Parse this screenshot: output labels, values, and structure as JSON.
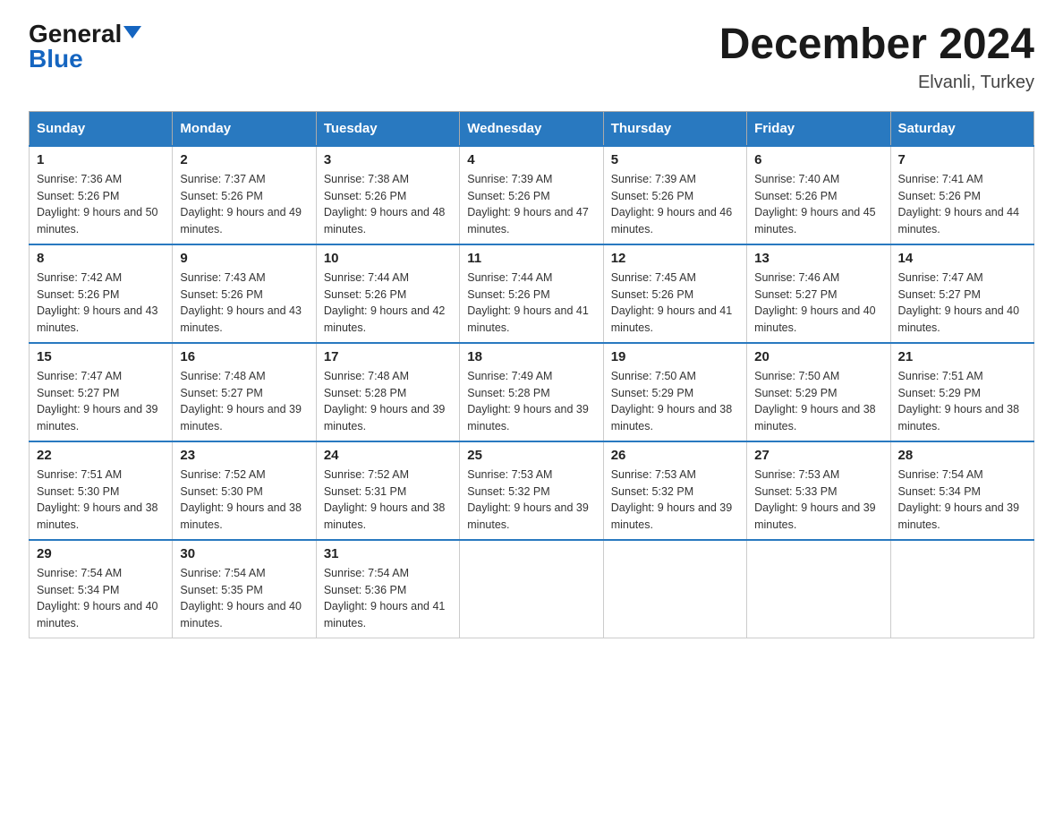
{
  "header": {
    "logo_general": "General",
    "logo_blue": "Blue",
    "month_title": "December 2024",
    "location": "Elvanli, Turkey"
  },
  "days_of_week": [
    "Sunday",
    "Monday",
    "Tuesday",
    "Wednesday",
    "Thursday",
    "Friday",
    "Saturday"
  ],
  "weeks": [
    [
      {
        "day": "1",
        "sunrise": "7:36 AM",
        "sunset": "5:26 PM",
        "daylight": "9 hours and 50 minutes."
      },
      {
        "day": "2",
        "sunrise": "7:37 AM",
        "sunset": "5:26 PM",
        "daylight": "9 hours and 49 minutes."
      },
      {
        "day": "3",
        "sunrise": "7:38 AM",
        "sunset": "5:26 PM",
        "daylight": "9 hours and 48 minutes."
      },
      {
        "day": "4",
        "sunrise": "7:39 AM",
        "sunset": "5:26 PM",
        "daylight": "9 hours and 47 minutes."
      },
      {
        "day": "5",
        "sunrise": "7:39 AM",
        "sunset": "5:26 PM",
        "daylight": "9 hours and 46 minutes."
      },
      {
        "day": "6",
        "sunrise": "7:40 AM",
        "sunset": "5:26 PM",
        "daylight": "9 hours and 45 minutes."
      },
      {
        "day": "7",
        "sunrise": "7:41 AM",
        "sunset": "5:26 PM",
        "daylight": "9 hours and 44 minutes."
      }
    ],
    [
      {
        "day": "8",
        "sunrise": "7:42 AM",
        "sunset": "5:26 PM",
        "daylight": "9 hours and 43 minutes."
      },
      {
        "day": "9",
        "sunrise": "7:43 AM",
        "sunset": "5:26 PM",
        "daylight": "9 hours and 43 minutes."
      },
      {
        "day": "10",
        "sunrise": "7:44 AM",
        "sunset": "5:26 PM",
        "daylight": "9 hours and 42 minutes."
      },
      {
        "day": "11",
        "sunrise": "7:44 AM",
        "sunset": "5:26 PM",
        "daylight": "9 hours and 41 minutes."
      },
      {
        "day": "12",
        "sunrise": "7:45 AM",
        "sunset": "5:26 PM",
        "daylight": "9 hours and 41 minutes."
      },
      {
        "day": "13",
        "sunrise": "7:46 AM",
        "sunset": "5:27 PM",
        "daylight": "9 hours and 40 minutes."
      },
      {
        "day": "14",
        "sunrise": "7:47 AM",
        "sunset": "5:27 PM",
        "daylight": "9 hours and 40 minutes."
      }
    ],
    [
      {
        "day": "15",
        "sunrise": "7:47 AM",
        "sunset": "5:27 PM",
        "daylight": "9 hours and 39 minutes."
      },
      {
        "day": "16",
        "sunrise": "7:48 AM",
        "sunset": "5:27 PM",
        "daylight": "9 hours and 39 minutes."
      },
      {
        "day": "17",
        "sunrise": "7:48 AM",
        "sunset": "5:28 PM",
        "daylight": "9 hours and 39 minutes."
      },
      {
        "day": "18",
        "sunrise": "7:49 AM",
        "sunset": "5:28 PM",
        "daylight": "9 hours and 39 minutes."
      },
      {
        "day": "19",
        "sunrise": "7:50 AM",
        "sunset": "5:29 PM",
        "daylight": "9 hours and 38 minutes."
      },
      {
        "day": "20",
        "sunrise": "7:50 AM",
        "sunset": "5:29 PM",
        "daylight": "9 hours and 38 minutes."
      },
      {
        "day": "21",
        "sunrise": "7:51 AM",
        "sunset": "5:29 PM",
        "daylight": "9 hours and 38 minutes."
      }
    ],
    [
      {
        "day": "22",
        "sunrise": "7:51 AM",
        "sunset": "5:30 PM",
        "daylight": "9 hours and 38 minutes."
      },
      {
        "day": "23",
        "sunrise": "7:52 AM",
        "sunset": "5:30 PM",
        "daylight": "9 hours and 38 minutes."
      },
      {
        "day": "24",
        "sunrise": "7:52 AM",
        "sunset": "5:31 PM",
        "daylight": "9 hours and 38 minutes."
      },
      {
        "day": "25",
        "sunrise": "7:53 AM",
        "sunset": "5:32 PM",
        "daylight": "9 hours and 39 minutes."
      },
      {
        "day": "26",
        "sunrise": "7:53 AM",
        "sunset": "5:32 PM",
        "daylight": "9 hours and 39 minutes."
      },
      {
        "day": "27",
        "sunrise": "7:53 AM",
        "sunset": "5:33 PM",
        "daylight": "9 hours and 39 minutes."
      },
      {
        "day": "28",
        "sunrise": "7:54 AM",
        "sunset": "5:34 PM",
        "daylight": "9 hours and 39 minutes."
      }
    ],
    [
      {
        "day": "29",
        "sunrise": "7:54 AM",
        "sunset": "5:34 PM",
        "daylight": "9 hours and 40 minutes."
      },
      {
        "day": "30",
        "sunrise": "7:54 AM",
        "sunset": "5:35 PM",
        "daylight": "9 hours and 40 minutes."
      },
      {
        "day": "31",
        "sunrise": "7:54 AM",
        "sunset": "5:36 PM",
        "daylight": "9 hours and 41 minutes."
      },
      null,
      null,
      null,
      null
    ]
  ]
}
